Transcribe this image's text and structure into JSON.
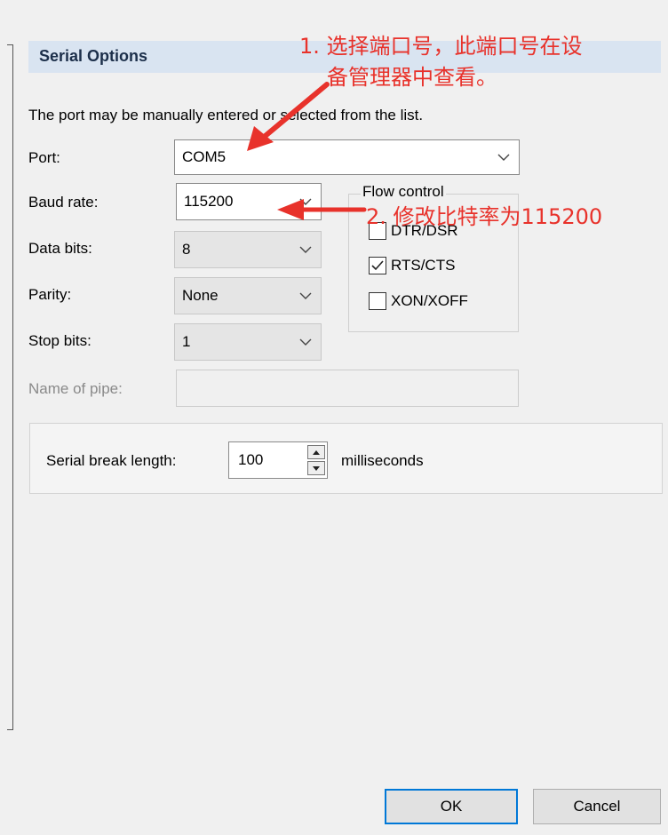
{
  "section": {
    "title": "Serial Options"
  },
  "description": "The port may be manually entered or selected from the list.",
  "fields": {
    "port": {
      "label": "Port:",
      "value": "COM5"
    },
    "baud_rate": {
      "label": "Baud rate:",
      "value": "115200"
    },
    "data_bits": {
      "label": "Data bits:",
      "value": "8"
    },
    "parity": {
      "label": "Parity:",
      "value": "None"
    },
    "stop_bits": {
      "label": "Stop bits:",
      "value": "1"
    },
    "name_of_pipe": {
      "label": "Name of pipe:",
      "value": ""
    }
  },
  "flow_control": {
    "title": "Flow control",
    "options": [
      {
        "label": "DTR/DSR",
        "checked": false
      },
      {
        "label": "RTS/CTS",
        "checked": true
      },
      {
        "label": "XON/XOFF",
        "checked": false
      }
    ]
  },
  "serial_break": {
    "label": "Serial break length:",
    "value": "100",
    "unit": "milliseconds"
  },
  "buttons": {
    "ok": "OK",
    "cancel": "Cancel"
  },
  "annotations": {
    "note1_line1": "1. 选择端口号，此端口号在设",
    "note1_line2": "备管理器中查看。",
    "note2": "2. 修改比特率为115200"
  },
  "colors": {
    "annotation": "#e8322b",
    "header_band": "#d9e4f1",
    "focus_border": "#0078d7"
  },
  "icons": [
    "chevron-down-icon",
    "checkmark-icon",
    "spin-up-icon",
    "spin-down-icon",
    "annotation-arrow"
  ]
}
